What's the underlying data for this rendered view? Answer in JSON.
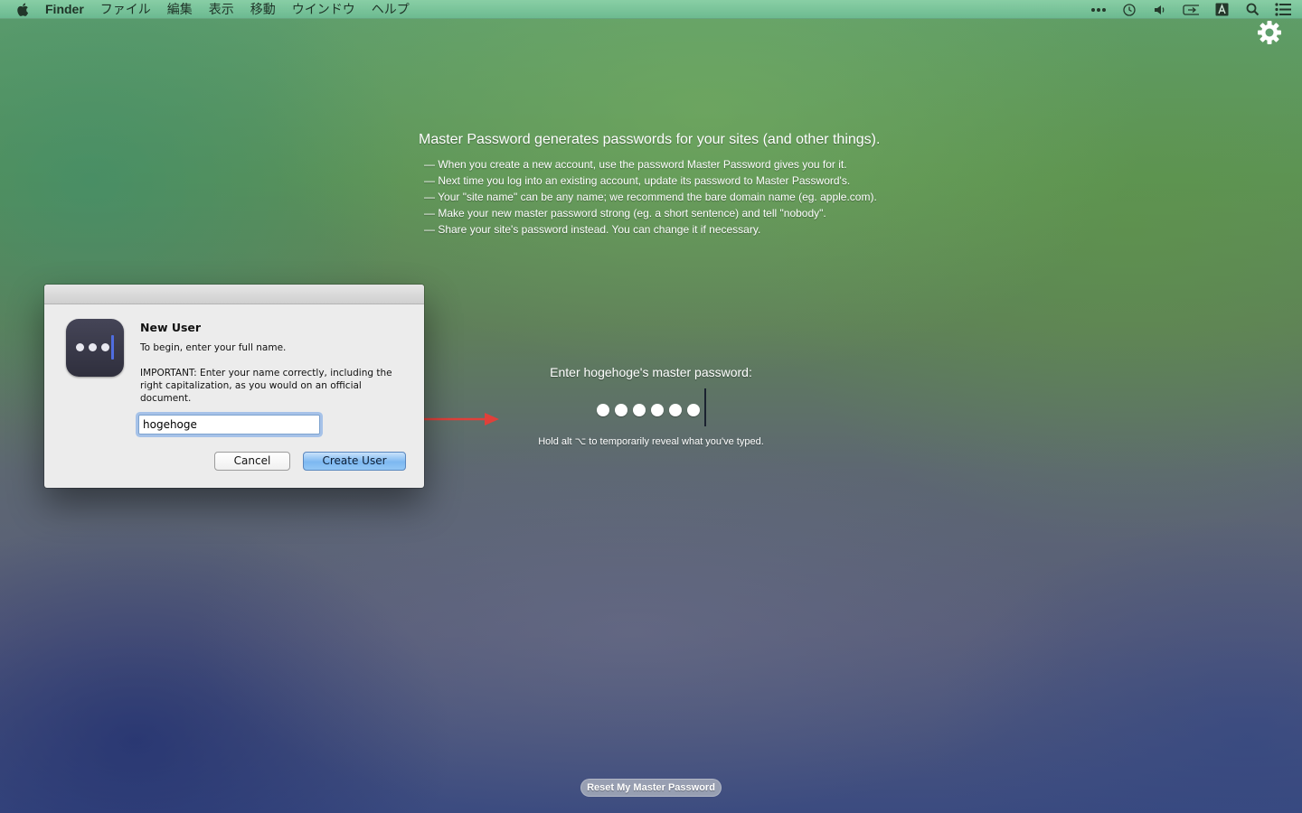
{
  "menubar": {
    "app_name": "Finder",
    "items": [
      "ファイル",
      "編集",
      "表示",
      "移動",
      "ウインドウ",
      "ヘルプ"
    ],
    "status_icons": [
      "more-icon",
      "time-machine-icon",
      "volume-icon",
      "battery-icon",
      "input-method-icon",
      "spotlight-icon",
      "notification-center-icon"
    ]
  },
  "intro": {
    "headline": "Master Password generates passwords for your sites (and other things).",
    "bullets": [
      "— When you create a new account, use the password Master Password gives you for it.",
      "— Next time you log into an existing account, update its password to Master Password's.",
      "— Your \"site name\" can be any name; we recommend the bare domain name (eg. apple.com).",
      "— Make your new master password strong (eg. a short sentence) and tell \"nobody\".",
      "— Share your site's password instead.  You can change it if necessary."
    ]
  },
  "master_password": {
    "label": "Enter hogehoge's master password:",
    "masked_length": 6,
    "hint": "Hold alt ⌥ to temporarily reveal what you've typed."
  },
  "dialog": {
    "title": "New User",
    "message1": "To begin, enter your full name.",
    "message2": "IMPORTANT: Enter your name correctly, including the right capitalization, as you would on an official document.",
    "name_value": "hogehoge",
    "cancel_label": "Cancel",
    "create_label": "Create User"
  },
  "reset_label": "Reset My Master Password",
  "colors": {
    "arrow": "#e0403a",
    "default_button": "#7db8f1",
    "app_icon_bar": "#4f6de0"
  }
}
